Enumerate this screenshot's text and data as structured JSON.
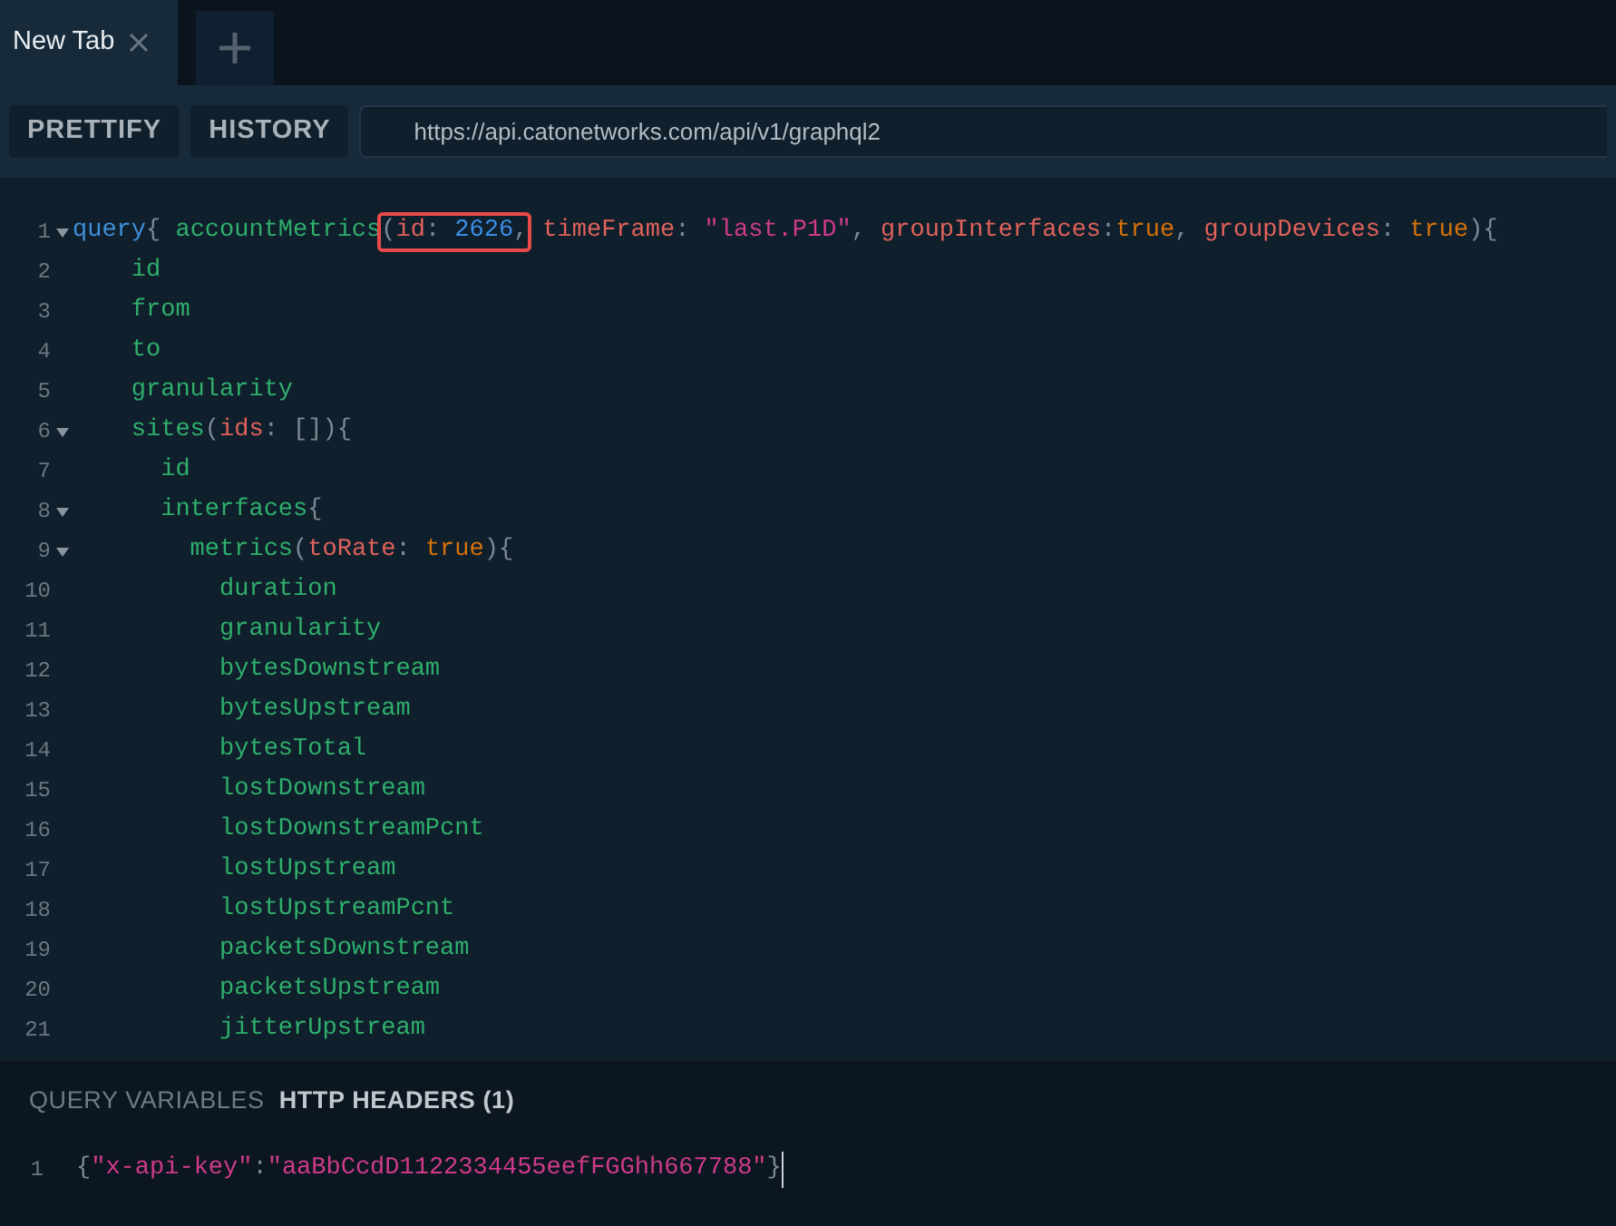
{
  "tabs": [
    {
      "label": "New Tab",
      "selected": true
    }
  ],
  "toolbar": {
    "buttons": [
      "PRETTIFY",
      "HISTORY"
    ],
    "url": "https://api.catonetworks.com/api/v1/graphql2"
  },
  "query_editor": {
    "lines": [
      {
        "number": "1",
        "foldable": true,
        "segments": [
          {
            "highlighted": false,
            "tokens": [
              {
                "kind": "keyword",
                "text": "query"
              },
              {
                "kind": "punct",
                "text": "{ "
              },
              {
                "kind": "field",
                "text": "accountMetrics"
              }
            ]
          },
          {
            "highlighted": true,
            "tokens": [
              {
                "kind": "punct",
                "text": "("
              },
              {
                "kind": "arg",
                "text": "id"
              },
              {
                "kind": "punct",
                "text": ": "
              },
              {
                "kind": "number",
                "text": "2626"
              },
              {
                "kind": "punct",
                "text": ","
              }
            ]
          },
          {
            "highlighted": false,
            "tokens": [
              {
                "kind": "arg",
                "text": "timeFrame"
              },
              {
                "kind": "punct",
                "text": ": "
              },
              {
                "kind": "string",
                "text": "\"last.P1D\""
              },
              {
                "kind": "punct",
                "text": ", "
              },
              {
                "kind": "arg",
                "text": "groupInterfaces"
              },
              {
                "kind": "punct",
                "text": ":"
              },
              {
                "kind": "bool",
                "text": "true"
              },
              {
                "kind": "punct",
                "text": ", "
              },
              {
                "kind": "arg",
                "text": "groupDevices"
              },
              {
                "kind": "punct",
                "text": ": "
              },
              {
                "kind": "bool",
                "text": "true"
              },
              {
                "kind": "punct",
                "text": "){"
              }
            ]
          }
        ]
      },
      {
        "number": "2",
        "foldable": false,
        "segments": [
          {
            "highlighted": false,
            "tokens": [
              {
                "kind": "field",
                "text": "    id"
              }
            ]
          }
        ]
      },
      {
        "number": "3",
        "foldable": false,
        "segments": [
          {
            "highlighted": false,
            "tokens": [
              {
                "kind": "field",
                "text": "    from"
              }
            ]
          }
        ]
      },
      {
        "number": "4",
        "foldable": false,
        "segments": [
          {
            "highlighted": false,
            "tokens": [
              {
                "kind": "field",
                "text": "    to"
              }
            ]
          }
        ]
      },
      {
        "number": "5",
        "foldable": false,
        "segments": [
          {
            "highlighted": false,
            "tokens": [
              {
                "kind": "field",
                "text": "    granularity"
              }
            ]
          }
        ]
      },
      {
        "number": "6",
        "foldable": true,
        "segments": [
          {
            "highlighted": false,
            "tokens": [
              {
                "kind": "field",
                "text": "    sites"
              },
              {
                "kind": "punct",
                "text": "("
              },
              {
                "kind": "arg",
                "text": "ids"
              },
              {
                "kind": "punct",
                "text": ": []){"
              }
            ]
          }
        ]
      },
      {
        "number": "7",
        "foldable": false,
        "segments": [
          {
            "highlighted": false,
            "tokens": [
              {
                "kind": "field",
                "text": "      id"
              }
            ]
          }
        ]
      },
      {
        "number": "8",
        "foldable": true,
        "segments": [
          {
            "highlighted": false,
            "tokens": [
              {
                "kind": "field",
                "text": "      interfaces"
              },
              {
                "kind": "punct",
                "text": "{"
              }
            ]
          }
        ]
      },
      {
        "number": "9",
        "foldable": true,
        "segments": [
          {
            "highlighted": false,
            "tokens": [
              {
                "kind": "field",
                "text": "        metrics"
              },
              {
                "kind": "punct",
                "text": "("
              },
              {
                "kind": "arg",
                "text": "toRate"
              },
              {
                "kind": "punct",
                "text": ": "
              },
              {
                "kind": "bool",
                "text": "true"
              },
              {
                "kind": "punct",
                "text": "){"
              }
            ]
          }
        ]
      },
      {
        "number": "10",
        "foldable": false,
        "segments": [
          {
            "highlighted": false,
            "tokens": [
              {
                "kind": "field",
                "text": "          duration"
              }
            ]
          }
        ]
      },
      {
        "number": "11",
        "foldable": false,
        "segments": [
          {
            "highlighted": false,
            "tokens": [
              {
                "kind": "field",
                "text": "          granularity"
              }
            ]
          }
        ]
      },
      {
        "number": "12",
        "foldable": false,
        "segments": [
          {
            "highlighted": false,
            "tokens": [
              {
                "kind": "field",
                "text": "          bytesDownstream"
              }
            ]
          }
        ]
      },
      {
        "number": "13",
        "foldable": false,
        "segments": [
          {
            "highlighted": false,
            "tokens": [
              {
                "kind": "field",
                "text": "          bytesUpstream"
              }
            ]
          }
        ]
      },
      {
        "number": "14",
        "foldable": false,
        "segments": [
          {
            "highlighted": false,
            "tokens": [
              {
                "kind": "field",
                "text": "          bytesTotal"
              }
            ]
          }
        ]
      },
      {
        "number": "15",
        "foldable": false,
        "segments": [
          {
            "highlighted": false,
            "tokens": [
              {
                "kind": "field",
                "text": "          lostDownstream"
              }
            ]
          }
        ]
      },
      {
        "number": "16",
        "foldable": false,
        "segments": [
          {
            "highlighted": false,
            "tokens": [
              {
                "kind": "field",
                "text": "          lostDownstreamPcnt"
              }
            ]
          }
        ]
      },
      {
        "number": "17",
        "foldable": false,
        "segments": [
          {
            "highlighted": false,
            "tokens": [
              {
                "kind": "field",
                "text": "          lostUpstream"
              }
            ]
          }
        ]
      },
      {
        "number": "18",
        "foldable": false,
        "segments": [
          {
            "highlighted": false,
            "tokens": [
              {
                "kind": "field",
                "text": "          lostUpstreamPcnt"
              }
            ]
          }
        ]
      },
      {
        "number": "19",
        "foldable": false,
        "segments": [
          {
            "highlighted": false,
            "tokens": [
              {
                "kind": "field",
                "text": "          packetsDownstream"
              }
            ]
          }
        ]
      },
      {
        "number": "20",
        "foldable": false,
        "segments": [
          {
            "highlighted": false,
            "tokens": [
              {
                "kind": "field",
                "text": "          packetsUpstream"
              }
            ]
          }
        ]
      },
      {
        "number": "21",
        "foldable": false,
        "segments": [
          {
            "highlighted": false,
            "tokens": [
              {
                "kind": "field",
                "text": "          jitterUpstream"
              }
            ]
          }
        ]
      }
    ]
  },
  "bottom_panel": {
    "tabs": [
      {
        "label": "QUERY VARIABLES",
        "selected": false
      },
      {
        "label": "HTTP HEADERS (1)",
        "selected": true
      }
    ],
    "lines": [
      {
        "number": "1",
        "cursor": true,
        "tokens": [
          {
            "kind": "punct",
            "text": "{"
          },
          {
            "kind": "string",
            "text": "\"x-api-key\""
          },
          {
            "kind": "punct",
            "text": ":"
          },
          {
            "kind": "string",
            "text": "\"aaBbCcdD1122334455eefFGGhh667788\""
          },
          {
            "kind": "punct",
            "text": "}"
          }
        ]
      }
    ]
  }
}
